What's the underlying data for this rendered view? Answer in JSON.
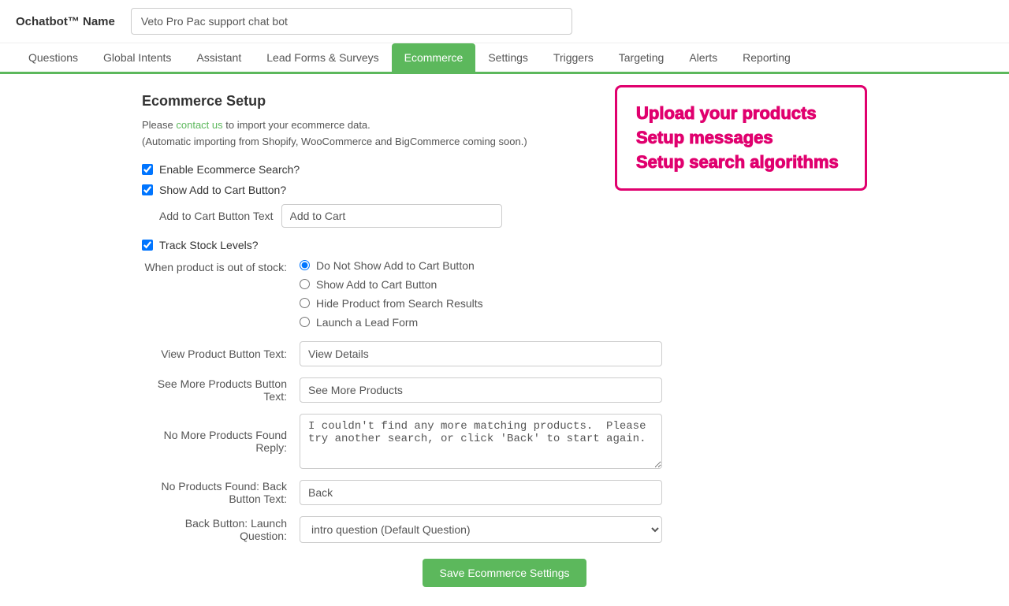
{
  "topBar": {
    "brand": "Ochatbot™ Name",
    "botNameValue": "Veto Pro Pac support chat bot",
    "botNamePlaceholder": "Bot name"
  },
  "nav": {
    "items": [
      {
        "label": "Questions",
        "active": false
      },
      {
        "label": "Global Intents",
        "active": false
      },
      {
        "label": "Assistant",
        "active": false
      },
      {
        "label": "Lead Forms & Surveys",
        "active": false
      },
      {
        "label": "Ecommerce",
        "active": true
      },
      {
        "label": "Settings",
        "active": false
      },
      {
        "label": "Triggers",
        "active": false
      },
      {
        "label": "Targeting",
        "active": false
      },
      {
        "label": "Alerts",
        "active": false
      },
      {
        "label": "Reporting",
        "active": false
      }
    ]
  },
  "page": {
    "title": "Ecommerce Setup",
    "introLine1": "Please contact us to import your ecommerce data.",
    "introLine2": "(Automatic importing from Shopify, WooCommerce and BigCommerce coming soon.)",
    "contactLinkText": "contact us"
  },
  "promo": {
    "lines": [
      "Upload your products",
      "Setup messages",
      "Setup search algorithms"
    ]
  },
  "form": {
    "enableEcommerceLabel": "Enable Ecommerce Search?",
    "showAddToCartLabel": "Show Add to Cart Button?",
    "addToCartButtonTextLabel": "Add to Cart Button Text",
    "addToCartButtonTextValue": "Add to Cart",
    "trackStockLabel": "Track Stock Levels?",
    "outOfStockLabel": "When product is out of stock:",
    "outOfStockOptions": [
      {
        "label": "Do Not Show Add to Cart Button",
        "value": "doNotShow",
        "selected": true
      },
      {
        "label": "Show Add to Cart Button",
        "value": "show",
        "selected": false
      },
      {
        "label": "Hide Product from Search Results",
        "value": "hide",
        "selected": false
      },
      {
        "label": "Launch a Lead Form",
        "value": "leadForm",
        "selected": false
      }
    ],
    "viewProductButtonTextLabel": "View Product Button Text:",
    "viewProductButtonTextValue": "View Details",
    "seeMoreProductsButtonTextLabel": "See More Products Button Text:",
    "seeMoreProductsButtonTextValue": "See More Products",
    "noMoreProductsReplyLabel": "No More Products Found Reply:",
    "noMoreProductsReplyValue": "I couldn't find any more matching products.  Please try another search, or click 'Back' to start again.",
    "noProductsFoundBackButtonTextLabel": "No Products Found: Back Button Text:",
    "noProductsFoundBackButtonTextValue": "Back",
    "backButtonLaunchQuestionLabel": "Back Button: Launch Question:",
    "backButtonLaunchQuestionValue": "intro question (Default Question)",
    "backButtonLaunchQuestionOptions": [
      "intro question (Default Question)"
    ],
    "saveButtonLabel": "Save Ecommerce Settings"
  }
}
